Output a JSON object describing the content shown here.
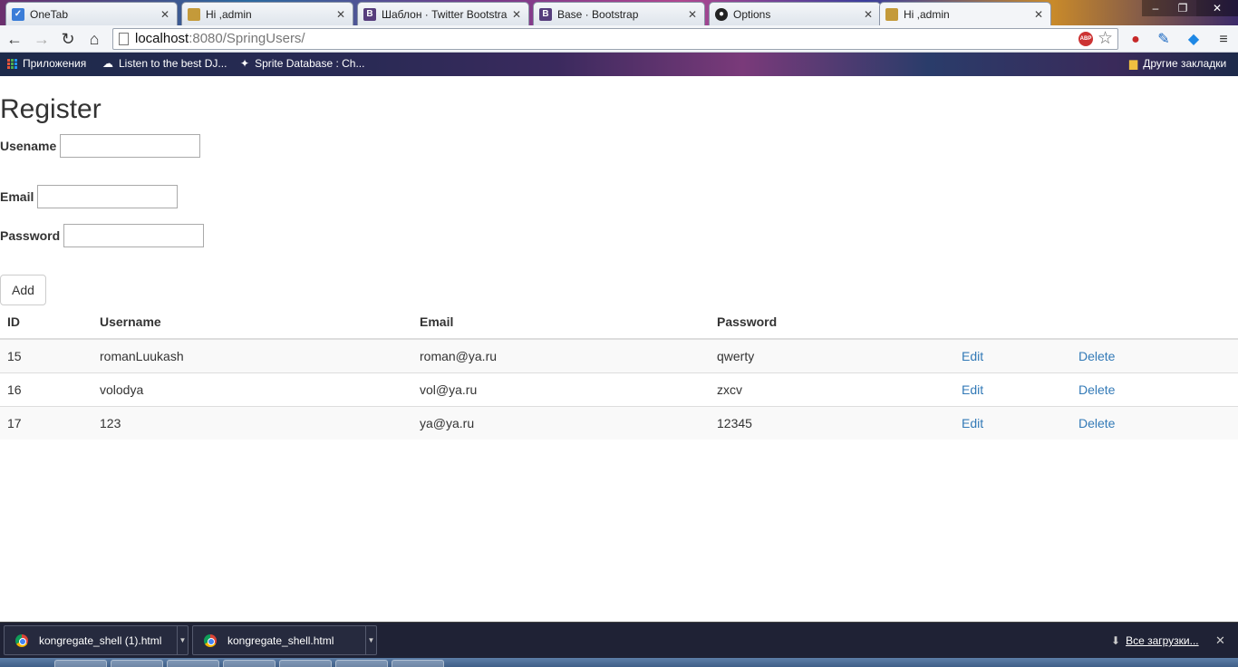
{
  "browser": {
    "tabs": [
      {
        "title": "OneTab",
        "favicon": "onetab-icon",
        "favicon_color": "#3b7dd8"
      },
      {
        "title": "Hi ,admin",
        "favicon": "page-icon",
        "favicon_color": "#c49a3a"
      },
      {
        "title": "Шаблон · Twitter Bootstra",
        "favicon": "bootstrap-icon",
        "favicon_color": "#563d7c"
      },
      {
        "title": "Base · Bootstrap",
        "favicon": "bootstrap-icon",
        "favicon_color": "#563d7c"
      },
      {
        "title": "Options",
        "favicon": "github-icon",
        "favicon_color": "#222222"
      },
      {
        "title": "Hi ,admin",
        "favicon": "page-icon",
        "favicon_color": "#c49a3a",
        "active": true
      }
    ],
    "address": {
      "host": "localhost",
      "path": ":8080/SpringUsers/"
    },
    "bookmarks": {
      "apps_label": "Приложения",
      "items": [
        "Listen to the best DJ...",
        "Sprite Database : Ch..."
      ],
      "other_label": "Другие закладки"
    }
  },
  "page": {
    "title": "Register",
    "form": {
      "username_label": "Usename",
      "username_value": "",
      "email_label": "Email",
      "email_value": "",
      "password_label": "Password",
      "password_value": "",
      "add_label": "Add"
    },
    "table": {
      "headers": [
        "ID",
        "Username",
        "Email",
        "Password",
        "",
        ""
      ],
      "rows": [
        {
          "id": "15",
          "username": "romanLuukash",
          "email": "roman@ya.ru",
          "password": "qwerty",
          "edit": "Edit",
          "delete": "Delete"
        },
        {
          "id": "16",
          "username": "volodya",
          "email": "vol@ya.ru",
          "password": "zxcv",
          "edit": "Edit",
          "delete": "Delete"
        },
        {
          "id": "17",
          "username": "123",
          "email": "ya@ya.ru",
          "password": "12345",
          "edit": "Edit",
          "delete": "Delete"
        }
      ]
    },
    "link_color": "#337ab7"
  },
  "downloads": {
    "items": [
      "kongregate_shell (1).html",
      "kongregate_shell.html"
    ],
    "all_label": "Все загрузки..."
  }
}
